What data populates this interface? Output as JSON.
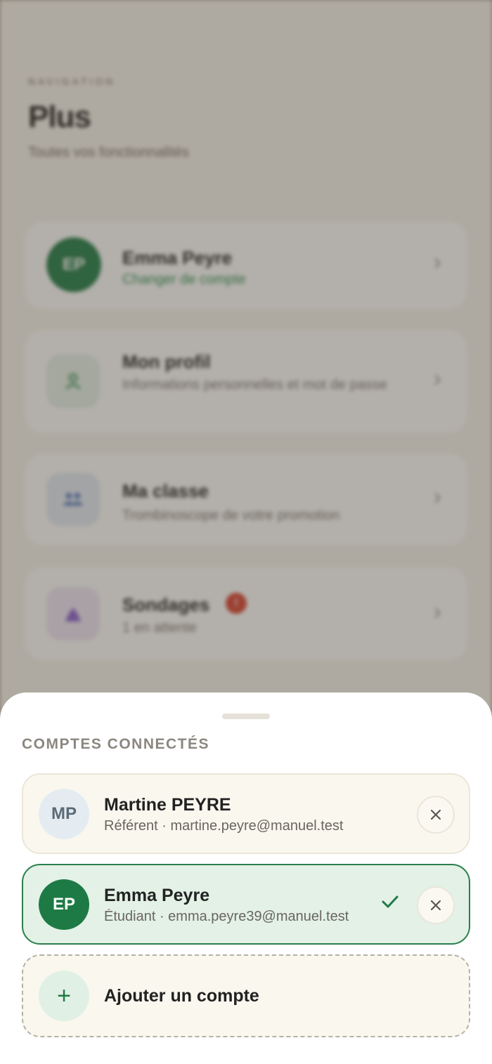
{
  "background": {
    "eyebrow": "NAVIGATION",
    "title": "Plus",
    "subtitle": "Toutes vos fonctionnalités",
    "current_account": {
      "initials": "EP",
      "name": "Emma Peyre",
      "action": "Changer de compte"
    },
    "menu": [
      {
        "title": "Mon profil",
        "subtitle": "Informations personnelles et mot de passe",
        "icon": "person-icon"
      },
      {
        "title": "Ma classe",
        "subtitle": "Trombinoscope de votre promotion",
        "icon": "group-icon"
      },
      {
        "title": "Sondages",
        "subtitle": "1 en attente",
        "icon": "poll-icon",
        "badge": "!"
      }
    ]
  },
  "sheet": {
    "title": "COMPTES CONNECTÉS",
    "accounts": [
      {
        "initials": "MP",
        "name": "Martine PEYRE",
        "meta": "Référent · martine.peyre@manuel.test",
        "active": false
      },
      {
        "initials": "EP",
        "name": "Emma Peyre",
        "meta": "Étudiant · emma.peyre39@manuel.test",
        "active": true
      }
    ],
    "add_icon": "+",
    "add_label": "Ajouter un compte"
  },
  "colors": {
    "brand_green": "#1e7a45",
    "active_bg": "#e3f1e6",
    "card_bg": "#faf7ef",
    "badge_red": "#d8402f"
  }
}
